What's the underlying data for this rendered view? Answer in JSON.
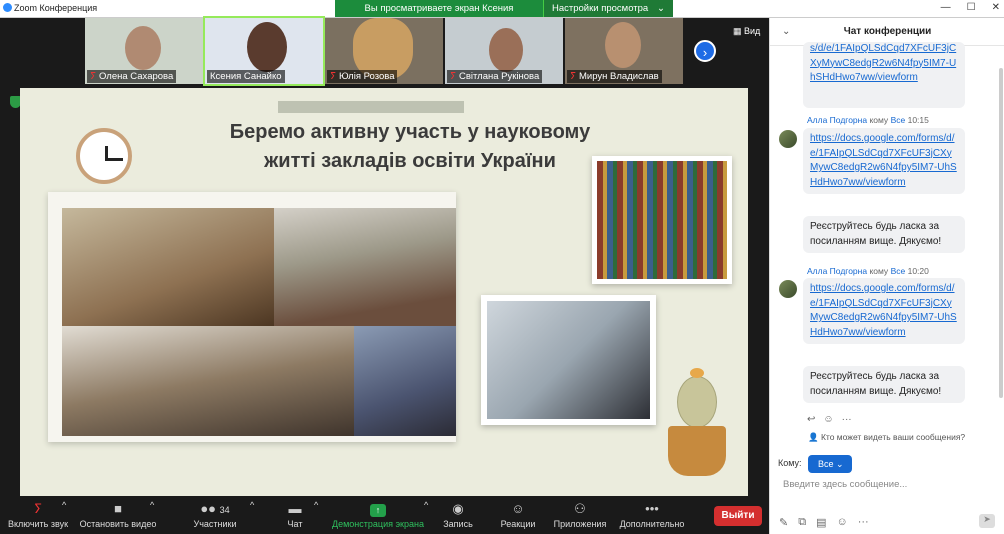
{
  "window": {
    "app_title": "Zoom Конференция",
    "minimize": "—",
    "maximize": "☐",
    "close": "✕"
  },
  "share_bar": {
    "viewing_text": "Вы просматриваете экран Ксения Санайко",
    "view_options": "Настройки просмотра",
    "caret": "⌄"
  },
  "participants": [
    {
      "name": "Олена Сахарова",
      "muted": false,
      "bg": "#ccd4c9"
    },
    {
      "name": "Ксения Санайко",
      "muted": false,
      "active": true,
      "bg": "#dfe5ee"
    },
    {
      "name": "Юлія Розова",
      "muted": true,
      "bg": "#c89d62"
    },
    {
      "name": "Світлана Рукінова",
      "muted": true,
      "bg": "#c5ccd0"
    },
    {
      "name": "Мирун Владислав",
      "muted": true,
      "bg": "#7e7160"
    }
  ],
  "view_button": "Вид",
  "slide": {
    "title_line1": "Беремо активну участь у науковому",
    "title_line2": "житті закладів освіти України"
  },
  "toolbar": {
    "audio": "Включить звук",
    "video": "Остановить видео",
    "participants": "Участники",
    "participants_count": "34",
    "chat": "Чат",
    "share": "Демонстрация экрана",
    "record": "Запись",
    "reactions": "Реакции",
    "apps": "Приложения",
    "more": "Дополнительно",
    "leave": "Выйти"
  },
  "chat": {
    "title": "Чат конференции",
    "messages": [
      {
        "link": "s/d/e/1FAIpQLSdCqd7XFcUF3jCXyMywC8edgR2w6N4fpy5IM7-UhSHdHwo7ww/viewform"
      },
      {
        "sender": "Алла Подгорна",
        "to_word": "кому",
        "to": "Все",
        "time": "10:15",
        "link": "https://docs.google.com/forms/d/e/1FAIpQLSdCqd7XFcUF3jCXyMywC8edgR2w6N4fpy5IM7-UhSHdHwo7ww/viewform",
        "text": "Реєструйтесь будь ласка за посиланням вище. Дякуємо!"
      },
      {
        "sender": "Алла Подгорна",
        "to_word": "кому",
        "to": "Все",
        "time": "10:20",
        "link": "https://docs.google.com/forms/d/e/1FAIpQLSdCqd7XFcUF3jCXyMywC8edgR2w6N4fpy5IM7-UhSHdHwo7ww/viewform",
        "text": "Реєструйтесь будь ласка за посиланням вище. Дякуємо!"
      }
    ],
    "who_sees": "Кто может видеть ваши сообщения?",
    "to_label": "Кому:",
    "to_value": "Все",
    "input_placeholder": "Введите здесь сообщение..."
  }
}
